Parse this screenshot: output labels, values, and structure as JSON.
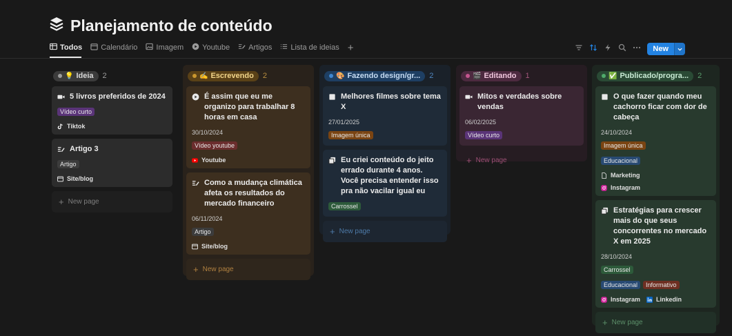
{
  "page": {
    "title": "Planejamento de conteúdo"
  },
  "tabs": [
    {
      "label": "Todos",
      "icon": "table-icon"
    },
    {
      "label": "Calendário",
      "icon": "calendar-icon"
    },
    {
      "label": "Imagem",
      "icon": "image-icon"
    },
    {
      "label": "Youtube",
      "icon": "play-icon"
    },
    {
      "label": "Artigos",
      "icon": "pen-lines-icon"
    },
    {
      "label": "Lista de ideias",
      "icon": "list-icon"
    }
  ],
  "toolbar": {
    "new_label": "New",
    "icons": [
      "filter-icon",
      "sort-icon",
      "automation-icon",
      "search-icon",
      "more-icon"
    ]
  },
  "colors": {
    "accent": "#2383e2"
  },
  "columns": [
    {
      "label": "Ideia",
      "emoji": "💡",
      "count": "2",
      "new_page": "New page",
      "cards": [
        {
          "title": "5 livros preferidos de 2024",
          "icon": "video-icon",
          "tags": [
            "Vídeo curto"
          ],
          "props": [
            {
              "icon": "tiktok-icon",
              "text": "Tiktok"
            }
          ]
        },
        {
          "title": "Artigo 3",
          "icon": "pen-lines-icon",
          "tags": [
            "Artigo"
          ],
          "props": [
            {
              "icon": "browser-icon",
              "text": "Site/blog"
            }
          ]
        }
      ]
    },
    {
      "label": "Escrevendo",
      "emoji": "✍",
      "count": "2",
      "new_page": "New page",
      "cards": [
        {
          "title": "É assim que eu me organizo para trabalhar 8 horas em casa",
          "icon": "play-icon",
          "date": "30/10/2024",
          "tags": [
            "Vídeo youtube"
          ],
          "props": [
            {
              "icon": "youtube-icon",
              "text": "Youtube"
            }
          ]
        },
        {
          "title": "Como a mudança climática afeta os resultados do mercado financeiro",
          "icon": "pen-lines-icon",
          "date": "06/11/2024",
          "tags": [
            "Artigo"
          ],
          "props": [
            {
              "icon": "browser-icon",
              "text": "Site/blog"
            }
          ]
        }
      ]
    },
    {
      "label": "Fazendo design/gr...",
      "emoji": "🎨",
      "count": "2",
      "new_page": "New page",
      "cards": [
        {
          "title": "Melhores filmes sobre tema X",
          "icon": "square-icon",
          "date": "27/01/2025",
          "tags": [
            "Imagem única"
          ],
          "props": []
        },
        {
          "title": "Eu criei conteúdo do jeito errado durante 4 anos. Você precisa entender isso pra não vacilar igual eu",
          "icon": "carousel-icon",
          "tags": [
            "Carrossel"
          ],
          "props": []
        }
      ]
    },
    {
      "label": "Editando",
      "emoji": "🎬",
      "count": "1",
      "new_page": "New page",
      "cards": [
        {
          "title": "Mitos e verdades sobre vendas",
          "icon": "video-icon",
          "date": "06/02/2025",
          "tags": [
            "Vídeo curto"
          ],
          "props": []
        }
      ]
    },
    {
      "label": "Publicado/progra...",
      "emoji": "✅",
      "count": "2",
      "new_page": "New page",
      "cards": [
        {
          "title": "O que fazer quando meu cachorro ficar com dor de cabeça",
          "icon": "square-icon",
          "date": "24/10/2024",
          "tags": [
            "Imagem única",
            "Educacional"
          ],
          "props": [
            {
              "icon": "page-icon",
              "text": "Marketing"
            },
            {
              "icon": "instagram-icon",
              "text": "Instagram"
            }
          ]
        },
        {
          "title": "Estratégias para crescer mais do que seus concorrentes no mercado X em 2025",
          "icon": "carousel-icon",
          "date": "28/10/2024",
          "tags": [
            "Carrossel",
            "Educacional",
            "Informativo"
          ],
          "props": [
            {
              "icon": "instagram-icon",
              "text": "Instagram"
            },
            {
              "icon": "linkedin-icon",
              "text": "Linkedin"
            }
          ]
        }
      ]
    }
  ]
}
